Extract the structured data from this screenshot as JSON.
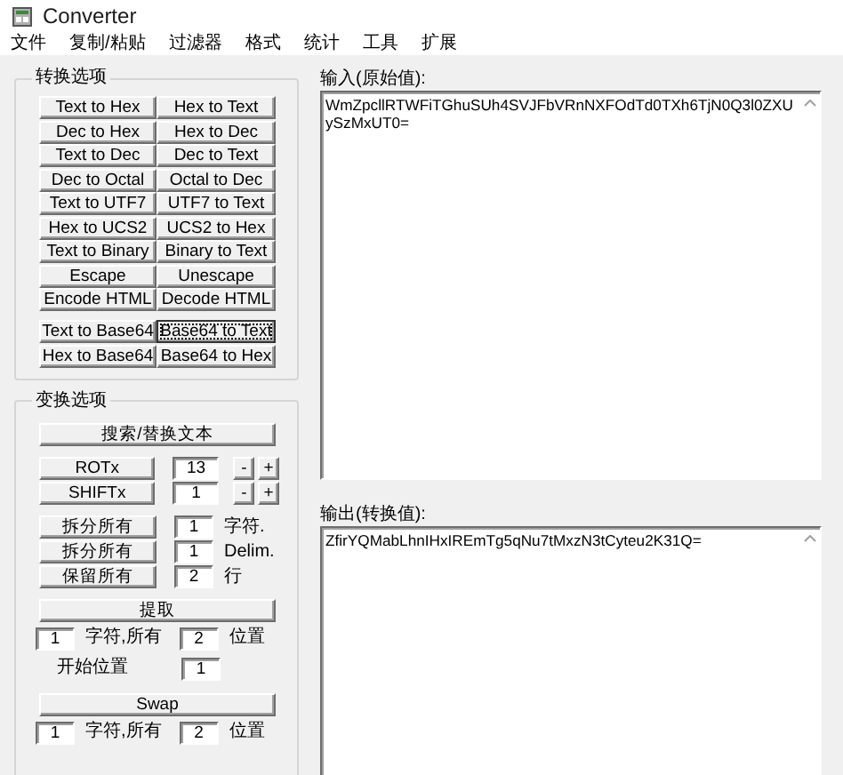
{
  "window": {
    "title": "Converter"
  },
  "menu": [
    "文件",
    "复制/粘贴",
    "过滤器",
    "格式",
    "统计",
    "工具",
    "扩展"
  ],
  "convert_options": {
    "title": "转换选项",
    "rows": [
      [
        {
          "label": "Text to Hex",
          "focused": false
        },
        {
          "label": "Hex to Text",
          "focused": false
        }
      ],
      [
        {
          "label": "Dec to Hex",
          "focused": false
        },
        {
          "label": "Hex to Dec",
          "focused": false
        }
      ],
      [
        {
          "label": "Text to Dec",
          "focused": false
        },
        {
          "label": "Dec to Text",
          "focused": false
        }
      ],
      [
        {
          "label": "Dec to Octal",
          "focused": false
        },
        {
          "label": "Octal to Dec",
          "focused": false
        }
      ],
      [
        {
          "label": "Text to UTF7",
          "focused": false
        },
        {
          "label": "UTF7 to Text",
          "focused": false
        }
      ],
      [
        {
          "label": "Hex to UCS2",
          "focused": false
        },
        {
          "label": "UCS2 to Hex",
          "focused": false
        }
      ],
      [
        {
          "label": "Text to Binary",
          "focused": false
        },
        {
          "label": "Binary to Text",
          "focused": false
        }
      ],
      [
        {
          "label": "Escape",
          "focused": false
        },
        {
          "label": "Unescape",
          "focused": false
        }
      ],
      [
        {
          "label": "Encode HTML",
          "focused": false
        },
        {
          "label": "Decode HTML",
          "focused": false
        }
      ]
    ],
    "base64_rows": [
      [
        {
          "label": "Text to Base64",
          "focused": false
        },
        {
          "label": "Base64 to Text",
          "focused": true
        }
      ],
      [
        {
          "label": "Hex to Base64",
          "focused": false
        },
        {
          "label": "Base64 to Hex",
          "focused": false
        }
      ]
    ]
  },
  "transform_options": {
    "title": "变换选项",
    "items": [
      {
        "kind": "wide_button",
        "label": "搜索/替换文本"
      },
      {
        "kind": "stepper",
        "label": "ROTx",
        "value": "13",
        "minus": "-",
        "plus": "+"
      },
      {
        "kind": "stepper",
        "label": "SHIFTx",
        "value": "1",
        "minus": "-",
        "plus": "+"
      },
      {
        "kind": "split",
        "label": "拆分所有",
        "value": "1",
        "unit": "字符."
      },
      {
        "kind": "split",
        "label": "拆分所有",
        "value": "1",
        "unit": "Delim."
      },
      {
        "kind": "split",
        "label": "保留所有",
        "value": "2",
        "unit": "行"
      },
      {
        "kind": "wide_button",
        "label": "提取"
      },
      {
        "kind": "pair",
        "value1": "1",
        "text1": "字符,所有",
        "value2": "2",
        "text2": "位置"
      },
      {
        "kind": "start",
        "text": "开始位置",
        "value": "1"
      },
      {
        "kind": "wide_button",
        "label": "Swap"
      },
      {
        "kind": "pair",
        "value1": "1",
        "text1": "字符,所有",
        "value2": "2",
        "text2": "位置"
      }
    ]
  },
  "input": {
    "label": "输入(原始值):",
    "value": "WmZpcllRTWFiTGhuSUh4SVJFbVRnNXFOdTd0TXh6TjN0Q3l0ZXUySzMxUT0="
  },
  "output": {
    "label": "输出(转换值):",
    "value": "ZfirYQMabLhnIHxIREmTg5qNu7tMxzN3tCyteu2K31Q="
  }
}
